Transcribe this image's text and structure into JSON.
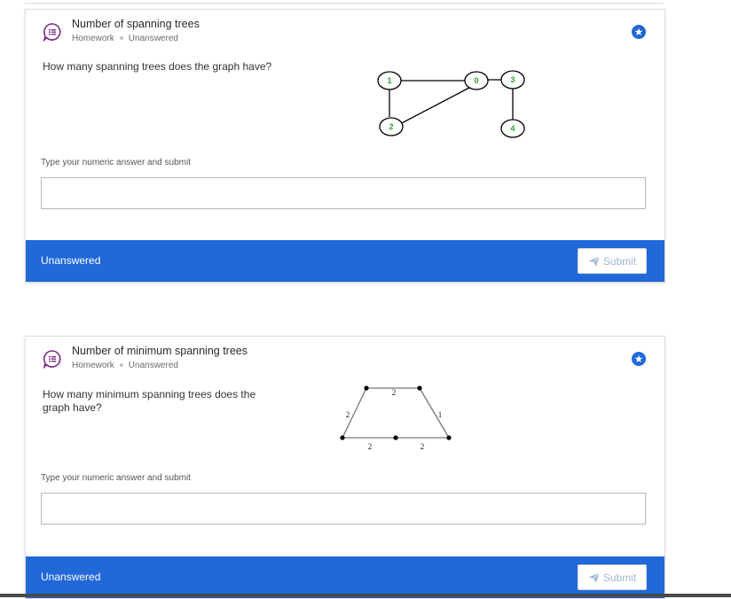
{
  "questions": [
    {
      "title": "Number of spanning trees",
      "category": "Homework",
      "state": "Unanswered",
      "prompt": "How many spanning trees does the graph have?",
      "answer_hint": "Type your numeric answer and submit",
      "answer_value": "",
      "status": "Unanswered",
      "submit_label": "Submit",
      "graph_nodes": [
        "1",
        "0",
        "3",
        "2",
        "4"
      ]
    },
    {
      "title": "Number of minimum spanning trees",
      "category": "Homework",
      "state": "Unanswered",
      "prompt": "How many minimum spanning trees does the graph have?",
      "answer_hint": "Type your numeric answer and submit",
      "answer_value": "",
      "status": "Unanswered",
      "submit_label": "Submit",
      "edge_weights": [
        "2",
        "2",
        "1",
        "2",
        "2"
      ]
    }
  ],
  "icons": {
    "question": "chat-question-icon",
    "star": "star-icon",
    "send": "paper-plane-icon"
  },
  "colors": {
    "accent": "#2168d9",
    "question_icon": "#7b2b86",
    "node_label": "#2aa52a"
  }
}
